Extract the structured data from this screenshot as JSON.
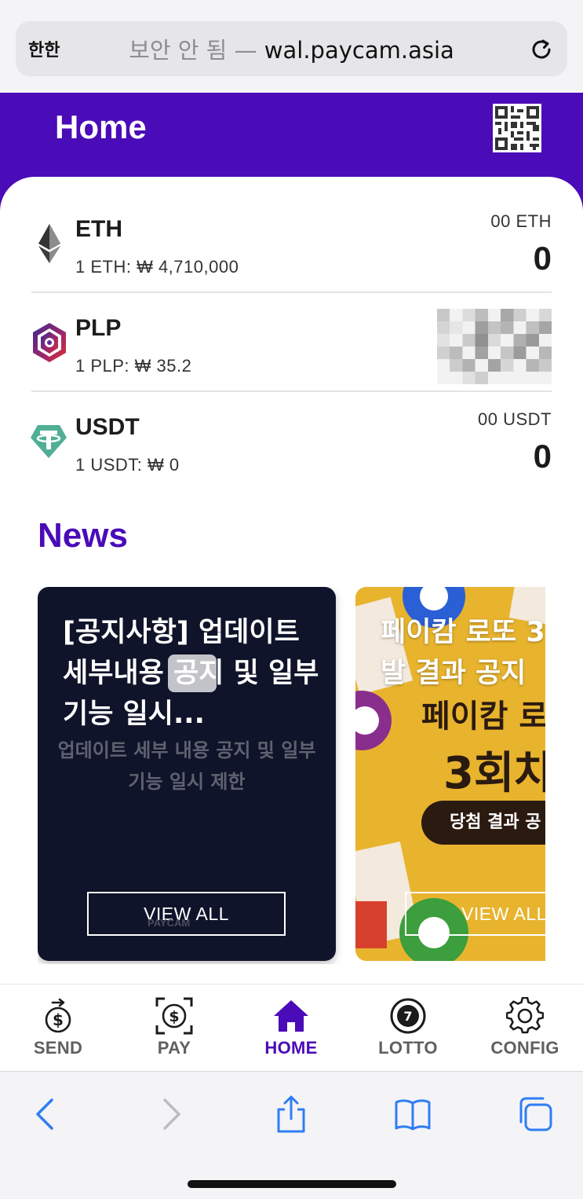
{
  "browser": {
    "aa_label": "한한",
    "security_label": "보안 안 됨",
    "separator": "—",
    "domain": "wal.paycam.asia"
  },
  "header": {
    "title": "Home",
    "qr_icon": "qr-code-icon"
  },
  "assets": [
    {
      "symbol": "ETH",
      "rate": "1 ETH: ₩ 4,710,000",
      "unit_label": "00 ETH",
      "amount": "0",
      "icon": "ethereum-icon",
      "color": "#343434"
    },
    {
      "symbol": "PLP",
      "rate": "1 PLP: ₩ 35.2",
      "unit_label": "",
      "amount": "",
      "icon": "plp-icon",
      "color": "#5b2a9a",
      "obscured": true
    },
    {
      "symbol": "USDT",
      "rate": "1 USDT: ₩ 0",
      "unit_label": "00 USDT",
      "amount": "0",
      "icon": "tether-icon",
      "color": "#50af95"
    }
  ],
  "news": {
    "title": "News",
    "cards": [
      {
        "headline": "[공지사항] 업데이트 세부내용 공지 및 일부기능 일시...",
        "subtitle": "업데이트 세부 내용 공지 및 일부 기능 일시 제한",
        "button": "VIEW ALL",
        "watermark": "PAYCAM"
      },
      {
        "headline": "페이캄 로또 3",
        "headline2": "발 결과 공지",
        "promo_line1": "페이캄 로",
        "promo_line2": "3회차",
        "promo_pill": "당첨 결과 공",
        "button": "VIEW ALL"
      }
    ]
  },
  "tabs": [
    {
      "label": "SEND",
      "icon": "send-icon",
      "active": false
    },
    {
      "label": "PAY",
      "icon": "pay-icon",
      "active": false
    },
    {
      "label": "HOME",
      "icon": "home-icon",
      "active": true
    },
    {
      "label": "LOTTO",
      "icon": "lotto-icon",
      "active": false
    },
    {
      "label": "CONFIG",
      "icon": "gear-icon",
      "active": false
    }
  ],
  "colors": {
    "brand": "#4a0bb8",
    "safari_blue": "#2f7df6"
  }
}
